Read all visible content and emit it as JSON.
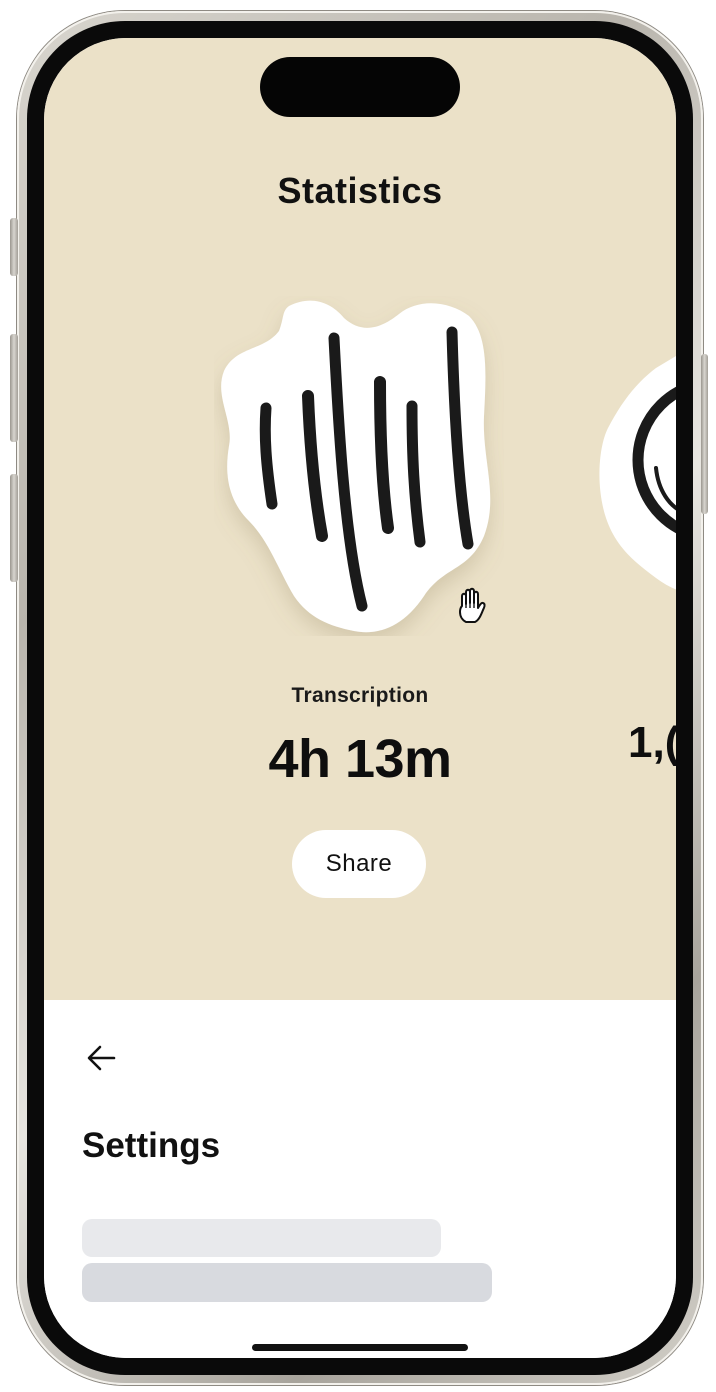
{
  "stats": {
    "title": "Statistics",
    "cards": [
      {
        "label": "Transcription",
        "value": "4h 13m",
        "share_label": "Share",
        "icon": "sound-wave-icon"
      },
      {
        "value_partial": "1,(",
        "icon": "circle-smile-icon"
      }
    ]
  },
  "settings": {
    "title": "Settings",
    "back_icon": "arrow-left-icon"
  },
  "colors": {
    "stats_background": "#ebe1c8",
    "settings_background": "#ffffff",
    "skeleton_light": "#e8e9ec",
    "skeleton_dark": "#d8dadf"
  },
  "cursor": "grab-hand-icon"
}
